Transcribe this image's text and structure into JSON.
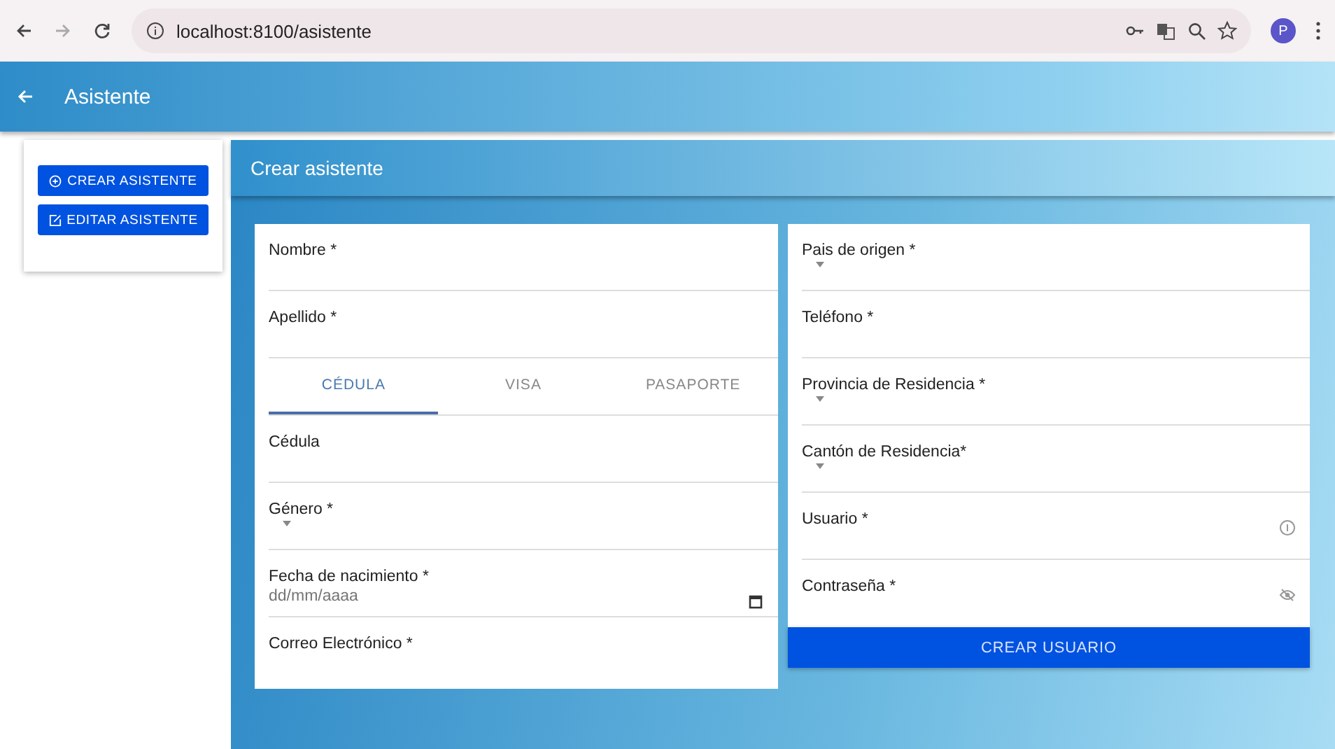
{
  "browser": {
    "url": "localhost:8100/asistente",
    "profile": "P"
  },
  "header": {
    "title": "Asistente"
  },
  "sidebar": {
    "buttons": [
      {
        "label": "CREAR ASISTENTE",
        "kind": "create"
      },
      {
        "label": "EDITAR ASISTENTE",
        "kind": "edit"
      }
    ]
  },
  "panel": {
    "title": "Crear asistente"
  },
  "left_fields": [
    {
      "label": "Nombre *"
    },
    {
      "label": "Apellido *"
    }
  ],
  "tabs": [
    {
      "label": "CÉDULA",
      "selected": true
    },
    {
      "label": "VISA",
      "selected": false
    },
    {
      "label": "PASAPORTE",
      "selected": false
    }
  ],
  "left_fields_after_tabs": [
    {
      "label": "Cédula"
    },
    {
      "label": "Género *",
      "kind": "select"
    },
    {
      "label": "Fecha de nacimiento *",
      "kind": "date",
      "placeholder": "dd/mm/aaaa"
    },
    {
      "label": "Correo Electrónico *"
    }
  ],
  "right_fields": [
    {
      "label": "Pais de origen *",
      "kind": "select"
    },
    {
      "label": "Teléfono *"
    },
    {
      "label": "Provincia de Residencia *",
      "kind": "select"
    },
    {
      "label": "Cantón de Residencia*",
      "kind": "select"
    },
    {
      "label": "Usuario *",
      "kind": "info"
    },
    {
      "label": "Contraseña *",
      "kind": "password"
    }
  ],
  "submit": {
    "label": "CREAR USUARIO"
  }
}
